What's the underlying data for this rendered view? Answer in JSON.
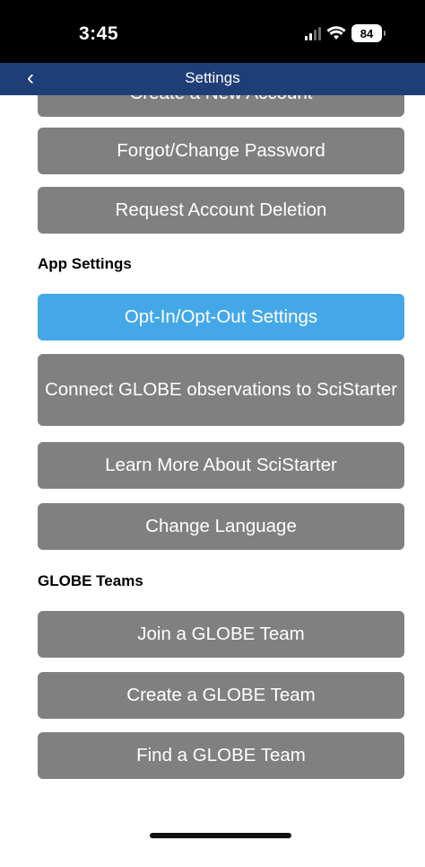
{
  "status_bar": {
    "time": "3:45",
    "battery": "84"
  },
  "nav": {
    "title": "Settings"
  },
  "account": {
    "create_account": "Create a New Account",
    "forgot_password": "Forgot/Change Password",
    "request_deletion": "Request Account Deletion"
  },
  "app_settings": {
    "heading": "App Settings",
    "opt_in_out": "Opt-In/Opt-Out Settings",
    "connect_scistarter": "Connect GLOBE observations to SciStarter",
    "learn_scistarter": "Learn More About SciStarter",
    "change_language": "Change Language"
  },
  "globe_teams": {
    "heading": "GLOBE Teams",
    "join_team": "Join a GLOBE Team",
    "create_team": "Create a GLOBE Team",
    "find_team": "Find a GLOBE Team"
  },
  "colors": {
    "nav": "#1f3e78",
    "primary_button": "#44a8e8",
    "button": "#808080"
  },
  "icons": {
    "back": "chevron-left-icon",
    "signal": "cellular-signal-icon",
    "wifi": "wifi-icon",
    "battery": "battery-icon"
  }
}
